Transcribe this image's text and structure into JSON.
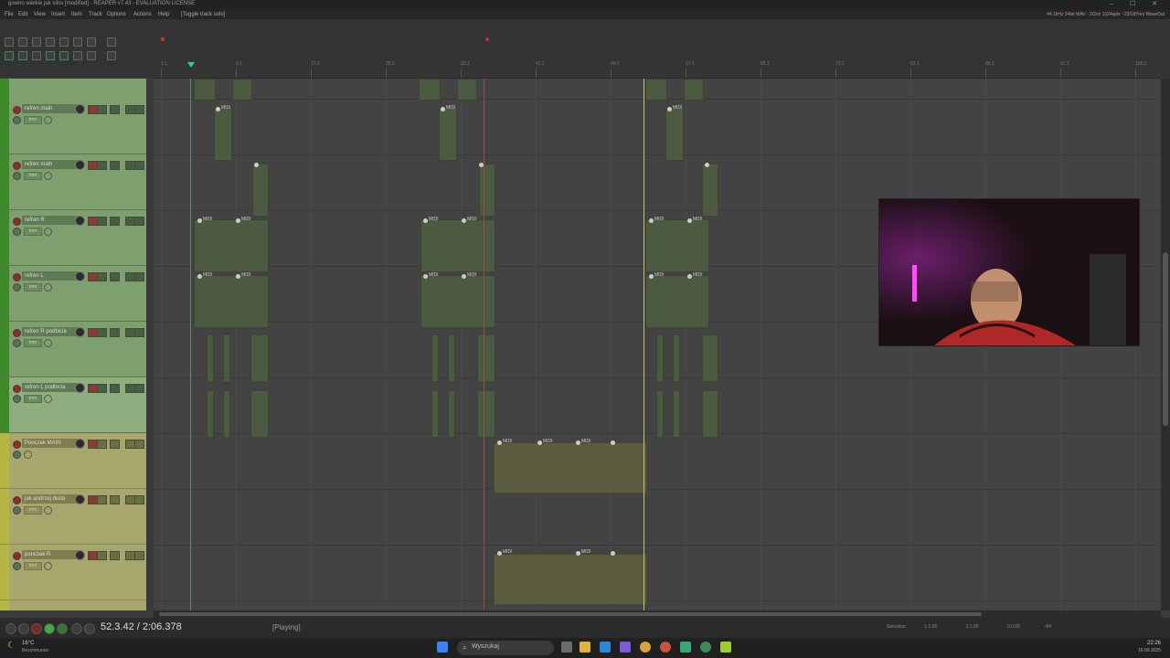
{
  "window": {
    "title": "gowno wielkie jak silos [modified] - REAPER v7.43 - EVALUATION LICENSE",
    "controls": "– ☐ ✕",
    "status": "44.1kHz 24bit WAV : 2/2ch 1024spls ~23/187ms WaveOut"
  },
  "menu": [
    "File",
    "Edit",
    "View",
    "Insert",
    "Item",
    "Track",
    "Options",
    "Actions",
    "Help",
    "[Toggle track solo]"
  ],
  "ruler": {
    "labels": [
      "1.1",
      "9.1",
      "17.1",
      "25.1",
      "33.1",
      "41.1",
      "49.1",
      "57.1",
      "65.1",
      "73.1",
      "81.1",
      "89.1",
      "97.1",
      "105.1"
    ]
  },
  "tracks": [
    {
      "name": "refren main",
      "color": "green"
    },
    {
      "name": "refren main",
      "color": "green"
    },
    {
      "name": "refren R",
      "color": "green"
    },
    {
      "name": "refren L",
      "color": "green"
    },
    {
      "name": "refren R podbicia",
      "color": "green"
    },
    {
      "name": "refren L podbicia",
      "color": "green"
    },
    {
      "name": "Ponczek MAIN",
      "color": "yellow"
    },
    {
      "name": "jak andrzej duda",
      "color": "yellow"
    },
    {
      "name": "ponczek R",
      "color": "yellow"
    }
  ],
  "track_buttons": {
    "mute": "M",
    "solo": "S",
    "fx": "FX",
    "io": "IO"
  },
  "sub_label": "trim",
  "item_label": "MIDI",
  "transport": {
    "time": "52.3.42 / 2:06.378",
    "state": "[Playing]",
    "selection_label": "Selection:",
    "selection_start": "1.1.00",
    "selection_end": "1.1.00",
    "selection_len": "0.0.00",
    "timesig": "4/4"
  },
  "taskbar": {
    "search_placeholder": "Wyszukaj",
    "weather_temp": "16°C",
    "weather_text": "Bezchmurnie",
    "clock_time": "22:26",
    "clock_date": "19.09.2025"
  },
  "colors": {
    "tcp_green": "#7ea06f",
    "tcp_yellow": "#a7a66c",
    "item_green": "#4b5a41",
    "play_green": "#3fae3f"
  }
}
